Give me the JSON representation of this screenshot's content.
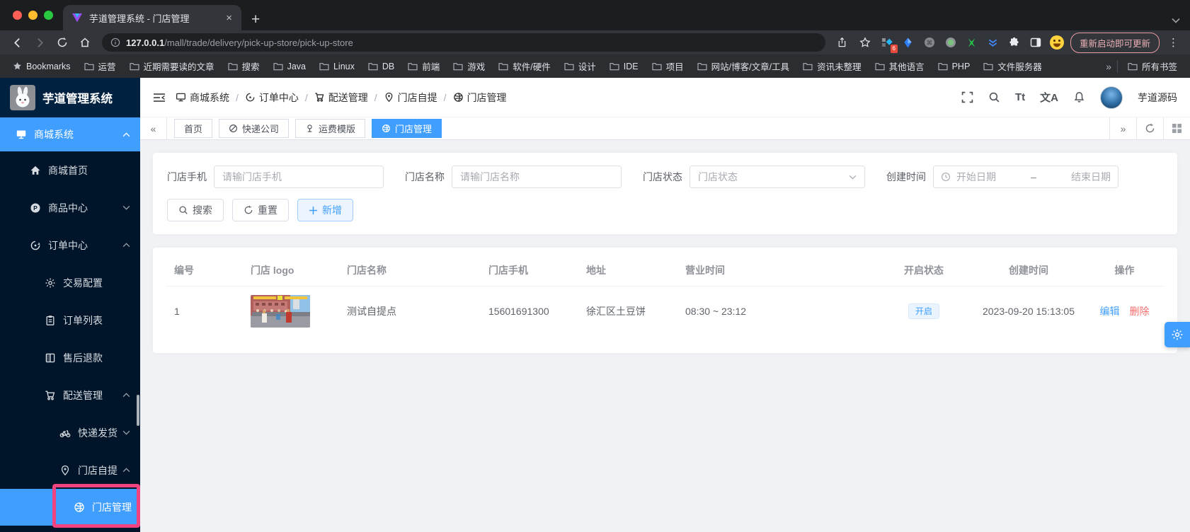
{
  "browser": {
    "tab_title": "芋道管理系统 - 门店管理",
    "close_glyph": "×",
    "new_tab_glyph": "+",
    "url_host": "127.0.0.1",
    "url_path": "/mall/trade/delivery/pick-up-store/pick-up-store",
    "extension_badge": "6",
    "update_button": "重新启动即可更新",
    "kebab_glyph": "⋮",
    "bookmarks": {
      "label": "Bookmarks",
      "folders": [
        "运营",
        "近期需要读的文章",
        "搜索",
        "Java",
        "Linux",
        "DB",
        "前端",
        "游戏",
        "软件/硬件",
        "设计",
        "IDE",
        "项目",
        "网站/博客/文章/工具",
        "资讯未整理",
        "其他语言",
        "PHP",
        "文件服务器"
      ],
      "overflow_glyph": "»",
      "all_bookmarks": "所有书签"
    }
  },
  "app": {
    "logo_title": "芋道管理系统",
    "breadcrumb": [
      {
        "label": "商城系统"
      },
      {
        "label": "订单中心"
      },
      {
        "label": "配送管理"
      },
      {
        "label": "门店自提"
      },
      {
        "label": "门店管理"
      }
    ],
    "separator": "/",
    "header_icons": {
      "font_size": "Tt",
      "translate": "文A"
    },
    "username": "芋道源码",
    "tagbar": {
      "prev_glyph": "«",
      "next_glyph": "»",
      "tags": [
        {
          "label": "首页",
          "active": false
        },
        {
          "label": "快递公司",
          "active": false
        },
        {
          "label": "运费模版",
          "active": false
        },
        {
          "label": "门店管理",
          "active": true
        }
      ]
    },
    "sidebar": {
      "items": [
        {
          "label": "商城系统",
          "level": 0,
          "active": true,
          "chevron": "up"
        },
        {
          "label": "商城首页",
          "level": 1
        },
        {
          "label": "商品中心",
          "level": 1,
          "chevron": "down"
        },
        {
          "label": "订单中心",
          "level": 1,
          "chevron": "up"
        },
        {
          "label": "交易配置",
          "level": 2
        },
        {
          "label": "订单列表",
          "level": 2
        },
        {
          "label": "售后退款",
          "level": 2
        },
        {
          "label": "配送管理",
          "level": 2,
          "chevron": "up"
        },
        {
          "label": "快递发货",
          "level": 3,
          "chevron": "down"
        },
        {
          "label": "门店自提",
          "level": 3,
          "chevron": "up"
        },
        {
          "label": "门店管理",
          "level": 4,
          "active": true
        }
      ]
    }
  },
  "filters": {
    "phone": {
      "label": "门店手机",
      "placeholder": "请输门店手机",
      "value": ""
    },
    "name": {
      "label": "门店名称",
      "placeholder": "请输门店名称",
      "value": ""
    },
    "status": {
      "label": "门店状态",
      "placeholder": "门店状态"
    },
    "created": {
      "label": "创建时间",
      "start_placeholder": "开始日期",
      "separator": "–",
      "end_placeholder": "结束日期"
    },
    "buttons": {
      "search": "搜索",
      "reset": "重置",
      "add": "新增"
    }
  },
  "table": {
    "columns": [
      "编号",
      "门店 logo",
      "门店名称",
      "门店手机",
      "地址",
      "营业时间",
      "开启状态",
      "创建时间",
      "操作"
    ],
    "rows": [
      {
        "id": "1",
        "logo_alt": "street-fighter-game-screenshot",
        "name": "测试自提点",
        "phone": "15601691300",
        "address": "徐汇区土豆饼",
        "hours": "08:30 ~ 23:12",
        "status": "开启",
        "created": "2023-09-20 15:13:05",
        "edit": "编辑",
        "delete": "删除"
      }
    ]
  },
  "colors": {
    "primary": "#409eff",
    "danger": "#f56c6c",
    "sidebar_bg": "#001529",
    "annotation_pink": "#f0437f",
    "status_tag_bg": "#e9f4ff",
    "add_button_bg": "#ecf5ff"
  }
}
